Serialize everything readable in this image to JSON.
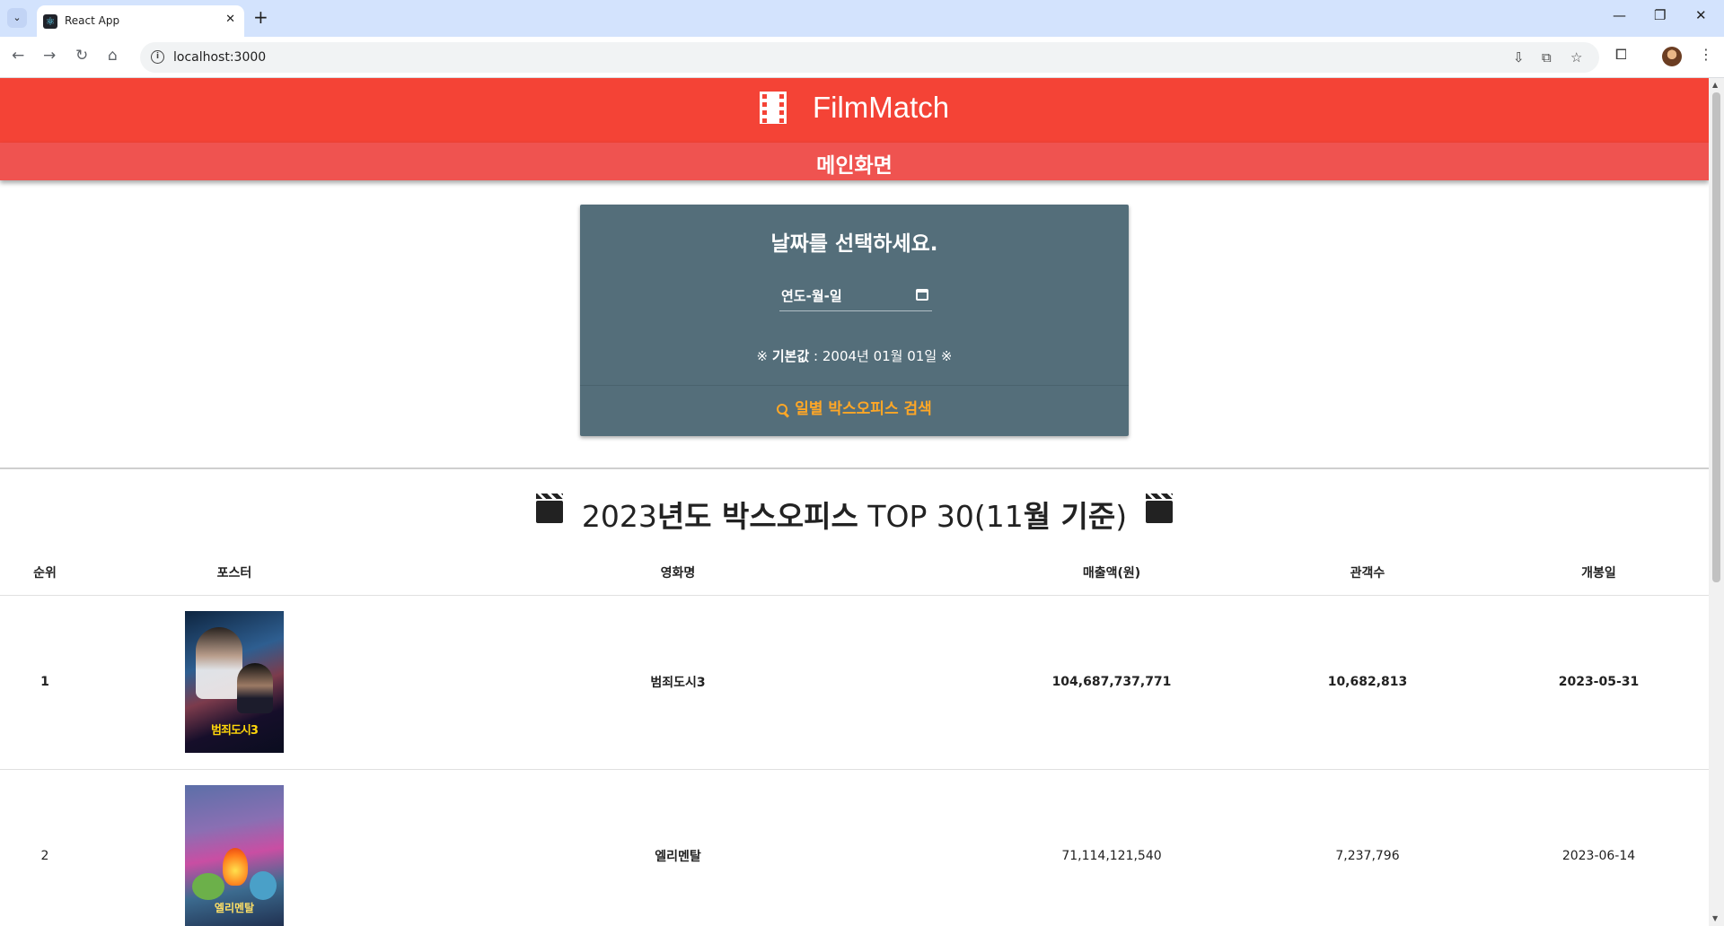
{
  "browser": {
    "tab_title": "React App",
    "url": "localhost:3000"
  },
  "header": {
    "brand": "FilmMatch",
    "subtitle": "메인화면"
  },
  "date_card": {
    "heading": "날짜를 선택하세요.",
    "date_placeholder": "연도-월-일",
    "default_label": "기본값",
    "default_value": " : 2004년 01월 01일 ",
    "note_mark": "※",
    "search_button": "일별 박스오피스 검색"
  },
  "section": {
    "title_prefix": "2023",
    "title_bold1": "년도 박스오피스",
    "title_mid": " TOP 30(11",
    "title_bold2": "월 기준",
    "title_suffix": ")"
  },
  "table": {
    "columns": [
      "순위",
      "포스터",
      "영화명",
      "매출액(원)",
      "관객수",
      "개봉일"
    ],
    "rows": [
      {
        "rank": "1",
        "poster_text": "범죄도시3",
        "title": "범죄도시3",
        "revenue": "104,687,737,771",
        "audience": "10,682,813",
        "release": "2023-05-31"
      },
      {
        "rank": "2",
        "poster_text": "엘리멘탈",
        "title": "엘리멘탈",
        "revenue": "71,114,121,540",
        "audience": "7,237,796",
        "release": "2023-06-14"
      }
    ]
  },
  "colors": {
    "appbar": "#f44336",
    "subbar": "#ef5350",
    "card": "#546e7a",
    "accent": "#ffa726"
  }
}
